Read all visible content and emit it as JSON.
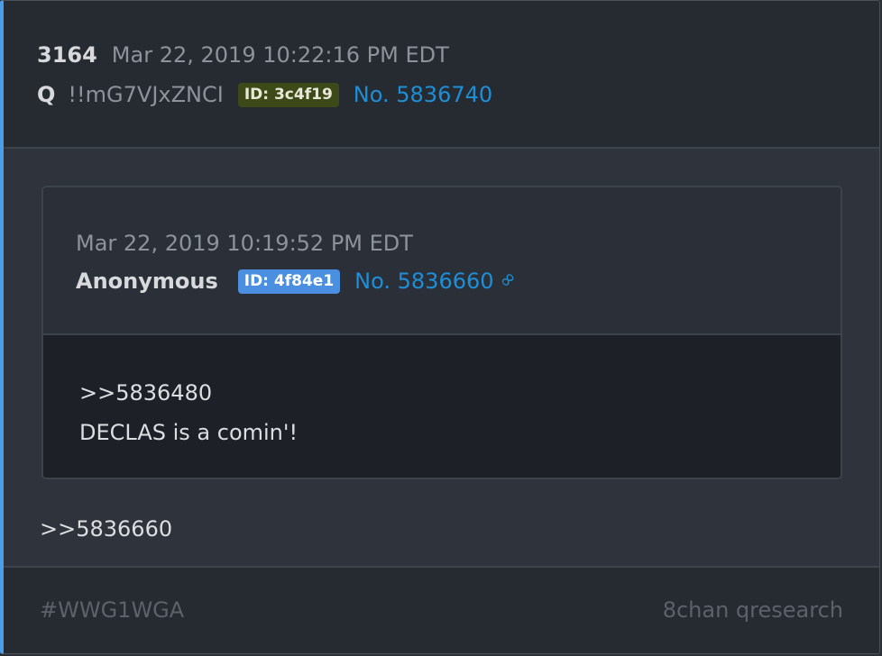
{
  "post": {
    "number": "3164",
    "date": "Mar 22, 2019 10:22:16 PM EDT",
    "author": "Q",
    "tripcode": "!!mG7VJxZNCI",
    "id_badge": "ID: 3c4f19",
    "post_no": "No. 5836740",
    "reply_text": ">>5836660"
  },
  "quoted": {
    "date": "Mar 22, 2019 10:19:52 PM EDT",
    "author": "Anonymous",
    "id_badge": "ID: 4f84e1",
    "post_no": "No. 5836660",
    "link_icon": "link-icon",
    "lines": [
      ">>5836480",
      "DECLAS is a comin'!"
    ]
  },
  "footer": {
    "hashtag": "#WWG1WGA",
    "source": "8chan qresearch"
  },
  "colors": {
    "accent": "#4a9fe8",
    "link": "#1e8fd6",
    "id_green": "#3d4a18",
    "id_blue": "#4a8fe0"
  }
}
